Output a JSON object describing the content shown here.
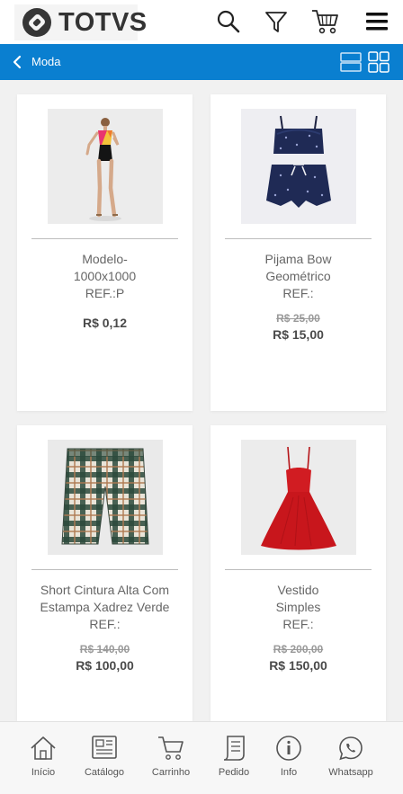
{
  "header": {
    "logo_text": "TOTVS",
    "icons": [
      "search-icon",
      "filter-icon",
      "cart-icon",
      "menu-icon"
    ]
  },
  "nav": {
    "title": "Moda",
    "accent_color": "#0a7fd0"
  },
  "products": [
    {
      "name": "Modelo-1000x1000",
      "name_lines": [
        "Modelo-",
        "1000x1000"
      ],
      "ref": "REF.:P",
      "old_price": "",
      "price": "R$ 0,12"
    },
    {
      "name": "Pijama Bow Geométrico",
      "name_lines": [
        "Pijama Bow",
        "Geométrico"
      ],
      "ref": "REF.:",
      "old_price": "R$ 25,00",
      "price": "R$ 15,00"
    },
    {
      "name": "Short Cintura Alta Com Estampa Xadrez Verde",
      "name_lines": [
        "Short Cintura Alta Com",
        "Estampa Xadrez Verde"
      ],
      "ref": "REF.:",
      "old_price": "R$ 140,00",
      "price": "R$ 100,00"
    },
    {
      "name": "Vestido Simples",
      "name_lines": [
        "Vestido",
        "Simples"
      ],
      "ref": "REF.:",
      "old_price": "R$ 200,00",
      "price": "R$ 150,00"
    }
  ],
  "bottom_nav": [
    {
      "label": "Início",
      "icon": "home-icon"
    },
    {
      "label": "Catálogo",
      "icon": "catalog-icon"
    },
    {
      "label": "Carrinho",
      "icon": "cart-icon"
    },
    {
      "label": "Pedido",
      "icon": "order-icon"
    },
    {
      "label": "Info",
      "icon": "info-icon"
    },
    {
      "label": "Whatsapp",
      "icon": "whatsapp-icon"
    }
  ]
}
